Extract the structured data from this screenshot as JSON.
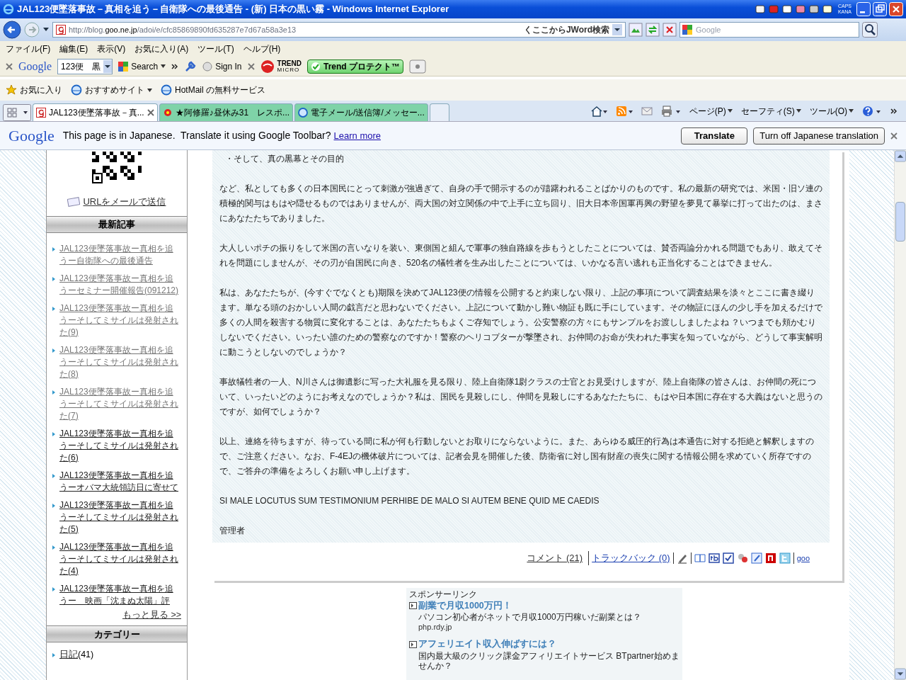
{
  "window": {
    "title": "JAL123便墜落事故－真相を追う－自衛隊への最後通告 - (新) 日本の黒い霧 - Windows Internet Explorer",
    "indicators": [
      "CAPS",
      "KANA"
    ]
  },
  "address_bar": {
    "url_prefix": "http://blog.",
    "url_host": "goo.ne.jp",
    "url_path": "/adoi/e/cfc85869890fd635287e7d67a58a3e13",
    "jword": "くここからJWord検索",
    "search_placeholder": "Google"
  },
  "menu": [
    "ファイル(F)",
    "編集(E)",
    "表示(V)",
    "お気に入り(A)",
    "ツール(T)",
    "ヘルプ(H)"
  ],
  "google_toolbar": {
    "logo": "Google",
    "query": "123便　黒",
    "search": "Search",
    "sign_in": "Sign In",
    "trend": "TREND",
    "trend_sub": "MICRO",
    "protect": "Trend プロテクト™"
  },
  "favorites": [
    "お気に入り",
    "おすすめサイト",
    "HotMail の無料サービス"
  ],
  "tabs": [
    {
      "label": "JAL123便墜落事故－真...",
      "selected": true
    },
    {
      "label": "★阿修羅♪昼休み31　レスポ...",
      "selected": false
    },
    {
      "label": "電子メール/送信簿/メッセー...",
      "selected": false
    }
  ],
  "command_bar": [
    "ページ(P)",
    "セーフティ(S)",
    "ツール(O)"
  ],
  "translate_bar": {
    "logo": "Google",
    "message": "This page is in Japanese.  Translate it using Google Toolbar?",
    "link": "Learn more",
    "buttons": [
      "Translate",
      "Turn off Japanese translation"
    ]
  },
  "sidebar": {
    "mail_link": "URLをメールで送信",
    "recent_title": "最新記事",
    "recent": [
      {
        "label": "JAL123便墜落事故ー真相を追うー自衛隊への最後通告",
        "visited": true
      },
      {
        "label": "JAL123便墜落事故ー真相を追うーセミナー開催報告(091212)",
        "visited": true
      },
      {
        "label": "JAL123便墜落事故ー真相を追うーそしてミサイルは発射された(9)",
        "visited": true
      },
      {
        "label": "JAL123便墜落事故ー真相を追うーそしてミサイルは発射された(8)",
        "visited": true
      },
      {
        "label": "JAL123便墜落事故ー真相を追うーそしてミサイルは発射された(7)",
        "visited": true
      },
      {
        "label": "JAL123便墜落事故ー真相を追うーそしてミサイルは発射された(6)",
        "visited": false
      },
      {
        "label": "JAL123便墜落事故ー真相を追うーオバマ大統領訪日に寄せて",
        "visited": false
      },
      {
        "label": "JAL123便墜落事故ー真相を追うーそしてミサイルは発射された(5)",
        "visited": false
      },
      {
        "label": "JAL123便墜落事故ー真相を追うーそしてミサイルは発射された(4)",
        "visited": false
      },
      {
        "label": "JAL123便墜落事故ー真相を追うー　映画「沈まぬ太陽」評",
        "visited": false
      }
    ],
    "more": "もっと見る >>",
    "category_title": "カテゴリー",
    "categories": [
      {
        "label": "日記",
        "count": "(41)"
      }
    ]
  },
  "post": {
    "paragraphs": [
      {
        "kind": "bullet",
        "text": "・そして、真の黒幕とその目的"
      },
      {
        "kind": "body",
        "text": "など、私としても多くの日本国民にとって刺激が強過ぎて、自身の手で開示するのが躊躇われることばかりのものです。私の最新の研究では、米国・旧ソ連の積極的関与はもはや隠せるものではありませんが、両大国の対立関係の中で上手に立ち回り、旧大日本帝国軍再興の野望を夢見て暴挙に打って出たのは、まさにあなたたちでありました。"
      },
      {
        "kind": "body",
        "text": "大人しいポチの振りをして米国の言いなりを装い、東側国と組んで軍事の独自路線を歩もうとしたことについては、賛否両論分かれる問題でもあり、敢えてそれを問題にしませんが、その刃が自国民に向き、520名の犠牲者を生み出したことについては、いかなる言い逃れも正当化することはできません。"
      },
      {
        "kind": "body",
        "text": "私は、あなたたちが、(今すぐでなくとも)期限を決めてJAL123便の情報を公開すると約束しない限り、上記の事項について調査結果を淡々とここに書き綴ります。単なる頭のおかしい人間の戯言だと思わないでください。上記について動かし難い物証も既に手にしています。その物証にほんの少し手を加えるだけで多くの人間を殺害する物質に変化することは、あなたたちもよくご存知でしょう。公安警察の方々にもサンプルをお渡ししましたよね ？いつまでも頬かむりしないでください。いったい誰のための警察なのですか！警察のヘリコプターが撃墜され、お仲間のお命が失われた事実を知っていながら、どうして事実解明に動こうとしないのでしょうか？"
      },
      {
        "kind": "body",
        "text": "事故犠牲者の一人、N川さんは御遺影に写った大礼服を見る限り、陸上自衛隊1尉クラスの士官とお見受けしますが、陸上自衛隊の皆さんは、お仲間の死について、いったいどのようにお考えなのでしょうか？私は、国民を見殺しにし、仲間を見殺しにするあなたたちに、もはや日本国に存在する大義はないと思うのですが、如何でしょうか？"
      },
      {
        "kind": "body",
        "text": "以上、連絡を待ちますが、待っている間に私が何も行動しないとお取りにならないように。また、あらゆる威圧的行為は本通告に対する拒絶と解釈しますので、ご注意ください。なお、F-4EJの機体破片については、記者会見を開催した後、防衛省に対し国有財産の喪失に関する情報公開を求めていく所存ですので、ご答弁の準備をよろしくお願い申し上げます。"
      },
      {
        "kind": "body",
        "text": "SI MALE LOCUTUS SUM TESTIMONIUM PERHIBE DE MALO SI AUTEM BENE QUID ME CAEDIS"
      },
      {
        "kind": "body",
        "text": "管理者"
      }
    ],
    "comments": "コメント (21)",
    "trackback": "トラックバック (0)",
    "goo": "goo"
  },
  "ads": {
    "label": "スポンサーリンク",
    "items": [
      {
        "title": "副業で月収1000万円！",
        "desc": "パソコン初心者がネットで月収1000万円稼いだ副業とは？",
        "url": "php.rdy.jp"
      },
      {
        "title": "アフェリエイト収入伸ばすには？",
        "desc": "国内最大級のクリック課金アフィリエイトサービス BTpartner始めませんか？"
      }
    ]
  }
}
